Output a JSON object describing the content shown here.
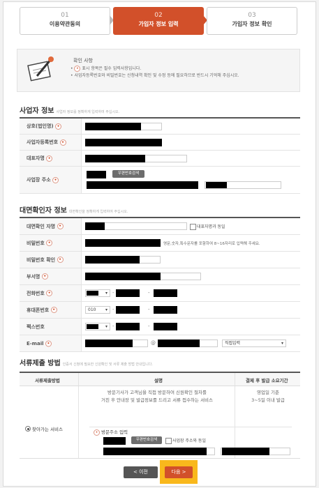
{
  "steps": [
    {
      "num": "01",
      "label": "이용약관동의"
    },
    {
      "num": "02",
      "label": "가입자 정보 입력"
    },
    {
      "num": "03",
      "label": "가입자 정보 확인"
    }
  ],
  "notice": {
    "title": "확인 사항",
    "items": [
      "표시 항목은 필수 입력사항입니다.",
      "사업자등록번호와 비밀번호는 신청내역 확인 및 수정 등에 필요하므로 반드시 기억해 주십시오."
    ],
    "req_mark": "•"
  },
  "business": {
    "title": "사업자 정보",
    "subtitle": "사업자 정보를 정확하게 입력하여 주십시오.",
    "labels": {
      "company": "상호(법인명)",
      "regno": "사업자등록번호",
      "ceo": "대표자명",
      "address": "사업장 주소"
    },
    "zip_button": "우편번호검색"
  },
  "identity": {
    "title": "대면확인자 정보",
    "subtitle": "대면확인을 정확하게 입력하여 주십시오.",
    "labels": {
      "name": "대면확인 자명",
      "password": "비밀번호",
      "password_confirm": "비밀번호 확인",
      "dept": "부서명",
      "phone": "전화번호",
      "mobile": "휴대폰번호",
      "fax": "팩스번호",
      "email": "E-mail"
    },
    "same_as_ceo": "대표자명과 동일",
    "password_hint": "영문,숫자,특수문자를 포함하여 8~16자리로 입력해 주세요.",
    "mobile_prefix": "010",
    "email_at": "@",
    "email_domain": "직접입력"
  },
  "documents": {
    "title": "서류제출 방법",
    "subtitle": "인증서 신청에 필요한 신원확인 및 서류 제출 방법 안내입니다.",
    "headers": [
      "서류제출방법",
      "설명",
      "결제 후 발급 소요기간"
    ],
    "method": "찾아가는 서비스",
    "description": [
      "방문기사가 고객님을 직접 방문하여 신원확인 절차를",
      "거친 후 안내장 및 발급정보를 드리고 서류 접수하는 서비스"
    ],
    "duration": [
      "영업일 기준",
      "3~5일 이내 발급"
    ],
    "visit_address": "방문주소 입력",
    "zip_button": "우편번호검색",
    "same_as_business": "사업장 주소와 동일"
  },
  "buttons": {
    "prev": "< 이전",
    "next": "다음 >"
  },
  "colors": {
    "accent": "#d2502a",
    "highlight": "#f9b81c"
  }
}
